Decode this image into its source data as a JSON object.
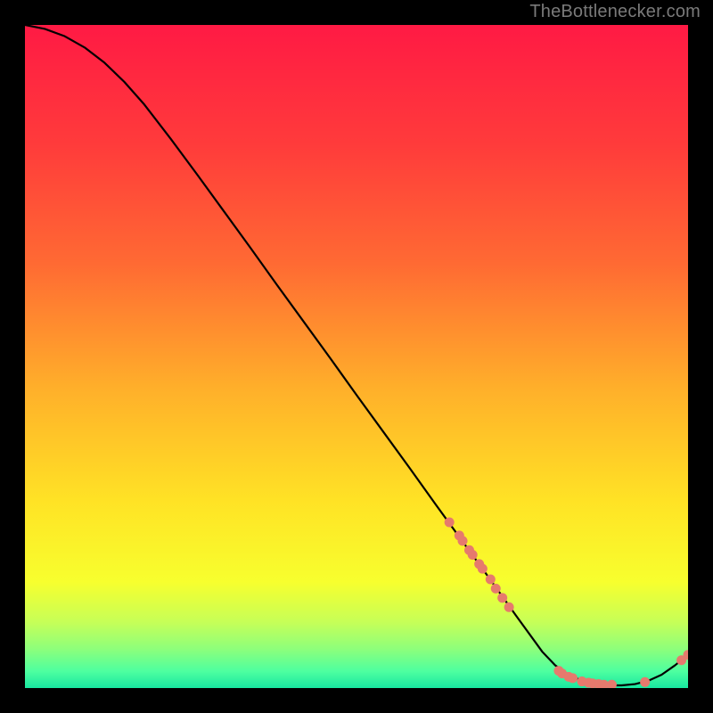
{
  "watermark": "TheBottlenecker.com",
  "chart_data": {
    "type": "line",
    "title": "",
    "xlabel": "",
    "ylabel": "",
    "xlim": [
      0,
      100
    ],
    "ylim": [
      0,
      100
    ],
    "grid": false,
    "legend": false,
    "notes": "Background is a vertical red→yellow→green gradient; curve is the primary black line; salmon dots mark highlighted samples on the curve. Axes have no tick labels.",
    "background_gradient_stops": [
      {
        "offset": 0.0,
        "color": "#ff1a44"
      },
      {
        "offset": 0.18,
        "color": "#ff3b3b"
      },
      {
        "offset": 0.36,
        "color": "#ff6a33"
      },
      {
        "offset": 0.55,
        "color": "#ffb02a"
      },
      {
        "offset": 0.72,
        "color": "#ffe325"
      },
      {
        "offset": 0.84,
        "color": "#f7ff2e"
      },
      {
        "offset": 0.9,
        "color": "#c7ff57"
      },
      {
        "offset": 0.94,
        "color": "#8fff7a"
      },
      {
        "offset": 0.975,
        "color": "#4dffa0"
      },
      {
        "offset": 1.0,
        "color": "#18e7a0"
      }
    ],
    "series": [
      {
        "name": "curve",
        "color": "#000000",
        "x": [
          0,
          3,
          6,
          9,
          12,
          15,
          18,
          22,
          26,
          30,
          34,
          38,
          42,
          46,
          50,
          54,
          58,
          62,
          66,
          70,
          74,
          78,
          80,
          82,
          84,
          86,
          88,
          90,
          92,
          94,
          96,
          98,
          100
        ],
        "y": [
          100.0,
          99.4,
          98.3,
          96.6,
          94.3,
          91.4,
          88.0,
          82.8,
          77.4,
          71.9,
          66.4,
          60.8,
          55.3,
          49.8,
          44.2,
          38.7,
          33.2,
          27.6,
          22.1,
          16.6,
          11.0,
          5.5,
          3.4,
          2.0,
          1.1,
          0.6,
          0.4,
          0.4,
          0.6,
          1.1,
          2.0,
          3.4,
          5.0
        ]
      }
    ],
    "highlight_points": {
      "color": "#e67a6d",
      "radius": 5.5,
      "points": [
        {
          "x": 64.0,
          "y": 25.0
        },
        {
          "x": 65.5,
          "y": 23.0
        },
        {
          "x": 66.0,
          "y": 22.2
        },
        {
          "x": 67.0,
          "y": 20.8
        },
        {
          "x": 67.5,
          "y": 20.1
        },
        {
          "x": 68.5,
          "y": 18.7
        },
        {
          "x": 69.0,
          "y": 18.0
        },
        {
          "x": 70.2,
          "y": 16.4
        },
        {
          "x": 71.0,
          "y": 15.0
        },
        {
          "x": 72.0,
          "y": 13.6
        },
        {
          "x": 73.0,
          "y": 12.2
        },
        {
          "x": 80.5,
          "y": 2.6
        },
        {
          "x": 81.0,
          "y": 2.2
        },
        {
          "x": 82.0,
          "y": 1.7
        },
        {
          "x": 82.6,
          "y": 1.5
        },
        {
          "x": 84.0,
          "y": 1.0
        },
        {
          "x": 85.0,
          "y": 0.8
        },
        {
          "x": 85.6,
          "y": 0.7
        },
        {
          "x": 86.5,
          "y": 0.6
        },
        {
          "x": 87.3,
          "y": 0.5
        },
        {
          "x": 88.5,
          "y": 0.5
        },
        {
          "x": 93.5,
          "y": 0.9
        },
        {
          "x": 99.0,
          "y": 4.2
        },
        {
          "x": 100.0,
          "y": 5.0
        }
      ]
    }
  }
}
